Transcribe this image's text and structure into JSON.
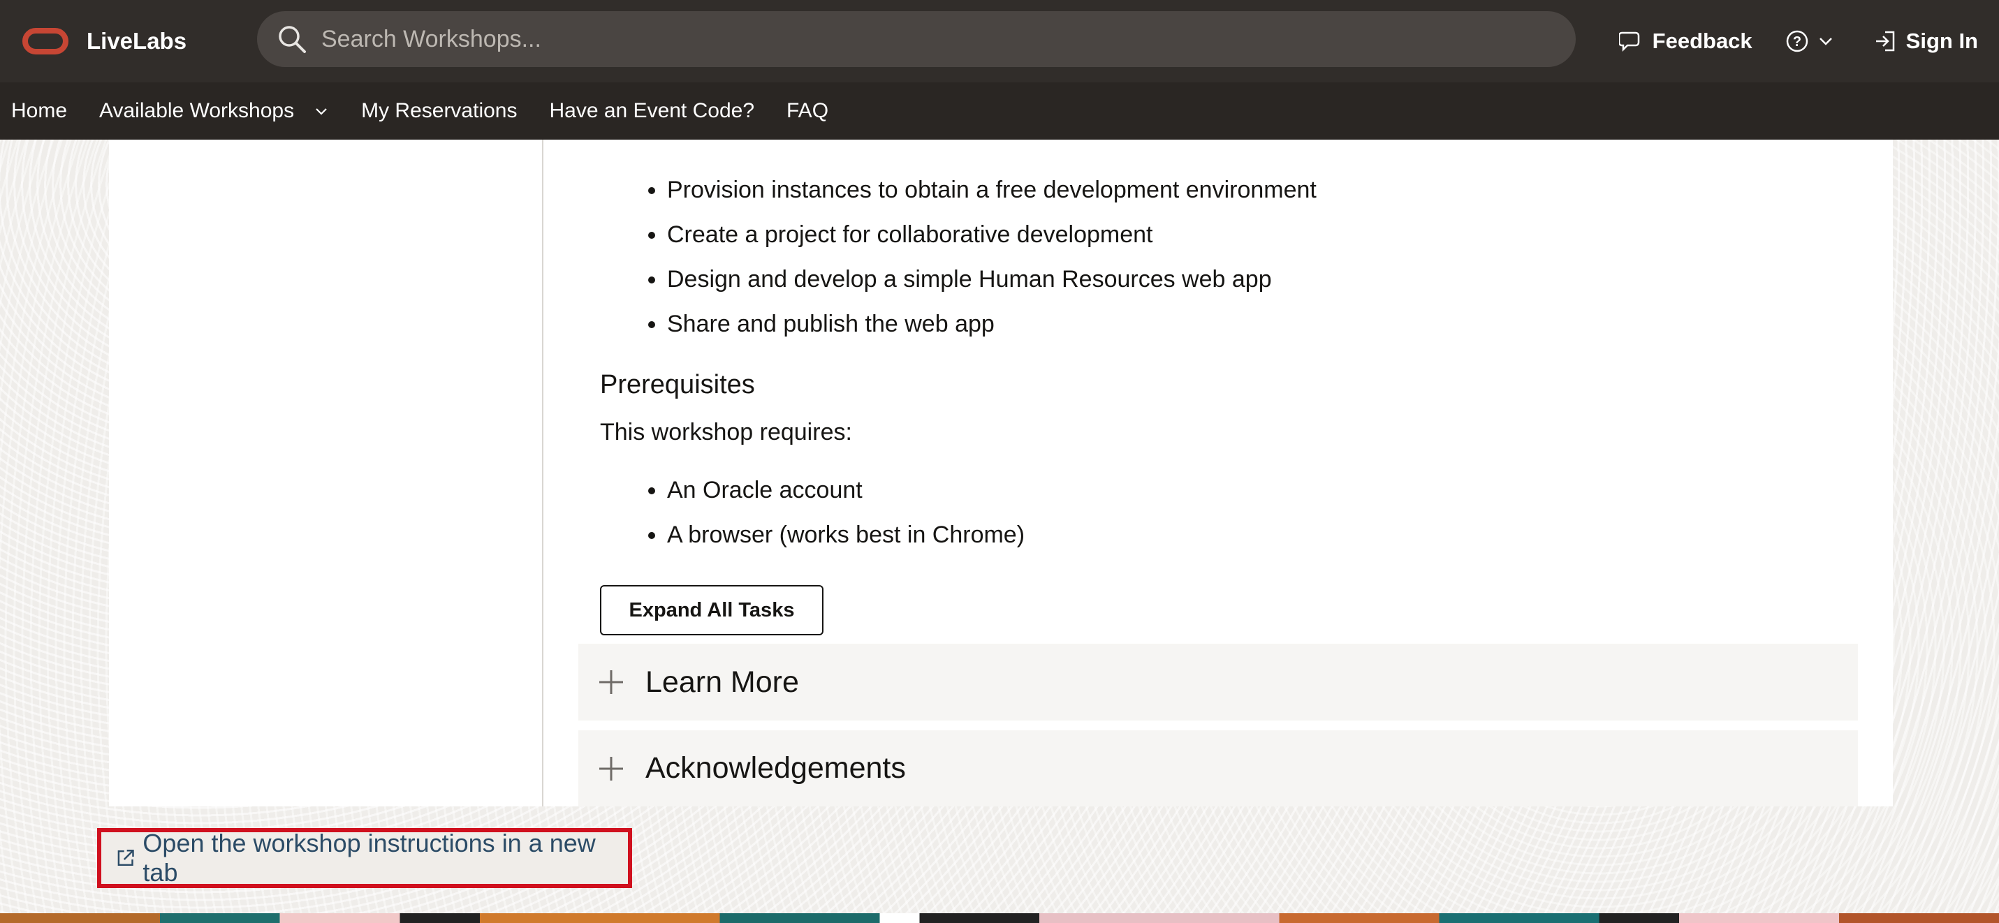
{
  "header": {
    "brand": "LiveLabs",
    "search_placeholder": "Search Workshops...",
    "feedback_label": "Feedback",
    "signin_label": "Sign In"
  },
  "nav": {
    "items": [
      "Home",
      "Available Workshops",
      "My Reservations",
      "Have an Event Code?",
      "FAQ"
    ]
  },
  "content": {
    "objectives": [
      "Provision instances to obtain a free development environment",
      "Create a project for collaborative development",
      "Design and develop a simple Human Resources web app",
      "Share and publish the web app"
    ],
    "prereq_heading": "Prerequisites",
    "prereq_text": "This workshop requires:",
    "prereqs": [
      "An Oracle account",
      "A browser (works best in Chrome)"
    ],
    "expand_button": "Expand All Tasks",
    "accordions": [
      "Learn More",
      "Acknowledgements"
    ]
  },
  "footer": {
    "open_link": "Open the workshop instructions in a new tab"
  },
  "colors": {
    "header_bg": "#312d2a",
    "nav_bg": "#2a2623",
    "brand_red": "#c74634",
    "highlight_red": "#d0101e",
    "link_blue": "#2b4b66"
  }
}
